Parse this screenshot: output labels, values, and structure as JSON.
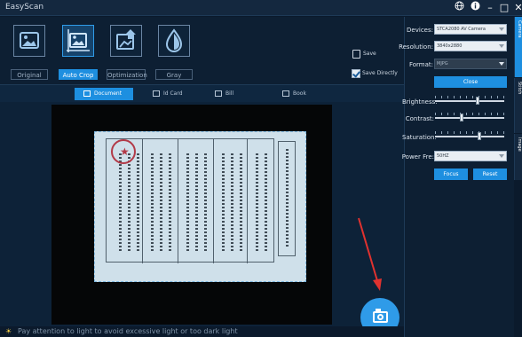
{
  "app": {
    "title": "EasyScan"
  },
  "window_controls": {
    "globe": "globe-icon",
    "info": "info-icon",
    "minimize": "–",
    "maximize": "□",
    "close": "✕"
  },
  "modes": [
    {
      "label": "Original",
      "icon": "image-icon"
    },
    {
      "label": "Auto Crop",
      "icon": "crop-image-icon",
      "active": true
    },
    {
      "label": "Optimization",
      "icon": "enhance-icon"
    },
    {
      "label": "Gray",
      "icon": "drop-icon"
    }
  ],
  "save": {
    "label": "Save",
    "save_directly": "Save Directly"
  },
  "subtabs": [
    {
      "label": "Document",
      "active": true
    },
    {
      "label": "Id Card"
    },
    {
      "label": "Bill"
    },
    {
      "label": "Book"
    }
  ],
  "status": {
    "text": "Pay attention to light to avoid excessive light or too dark light"
  },
  "panel": {
    "devices_label": "Devices:",
    "devices_value": "STCA2080 AV Camera",
    "resolution_label": "Resolution:",
    "resolution_value": "3840x2880",
    "format_label": "Format:",
    "format_value": "MJPG",
    "close_label": "Close",
    "brightness_label": "Brightness:",
    "brightness_value": 0.62,
    "contrast_label": "Contrast:",
    "contrast_value": 0.38,
    "saturation_label": "Saturation:",
    "saturation_value": 0.65,
    "power_label": "Power Fre:",
    "power_value": "50HZ",
    "focus_label": "Focus",
    "reset_label": "Reset"
  },
  "sidetabs": [
    "Camera",
    "Stitch",
    "Image"
  ],
  "colors": {
    "accent": "#1e8fe0",
    "bg": "#0b1a2c",
    "seal": "#b23a48"
  }
}
